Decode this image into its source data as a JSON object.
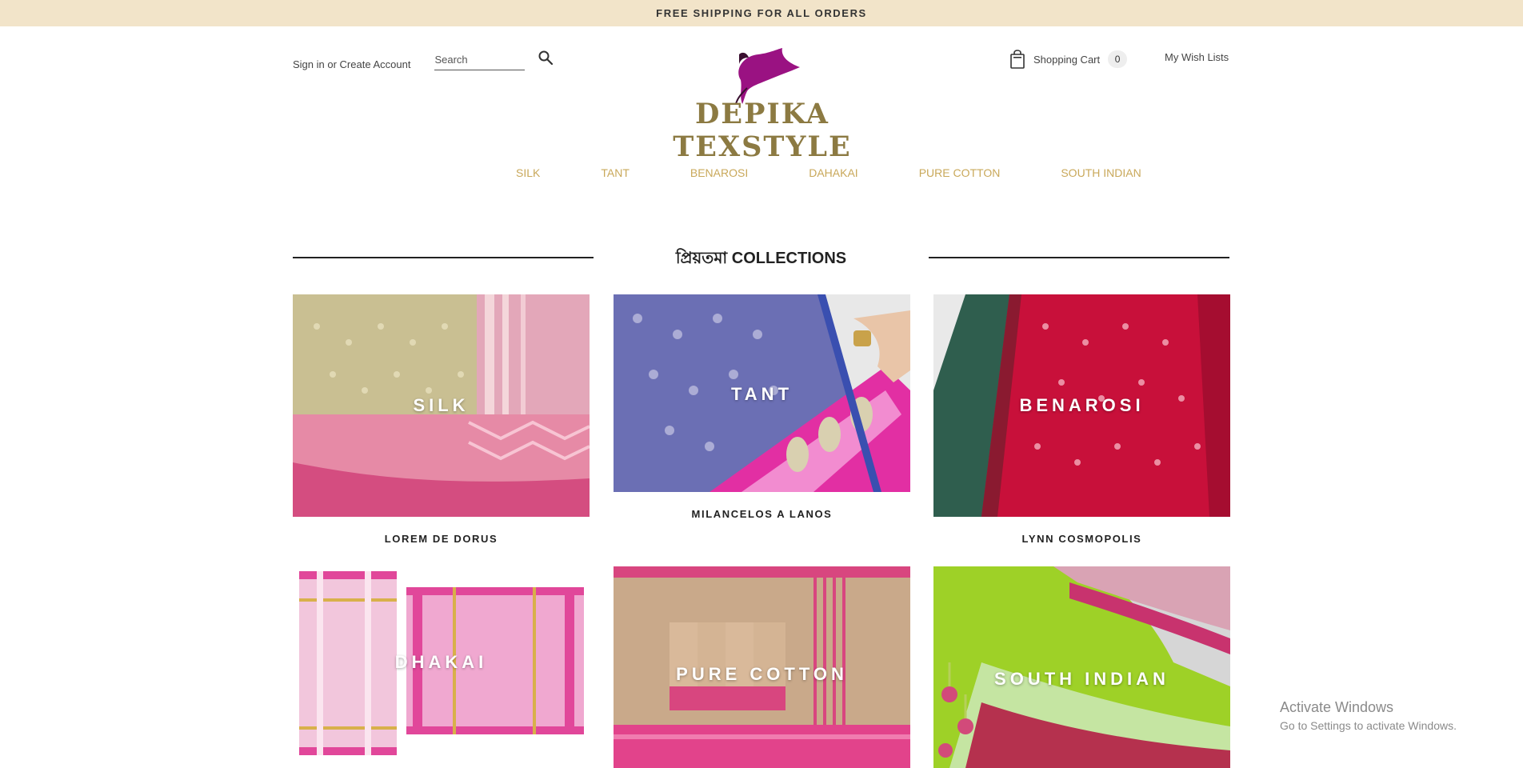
{
  "promo": {
    "text": "FREE SHIPPING FOR ALL ORDERS"
  },
  "header": {
    "signin": "Sign in",
    "or": " or ",
    "create_account": "Create Account",
    "search_placeholder": "Search",
    "cart_label": "Shopping Cart",
    "cart_count": "0",
    "wishlist": "My Wish Lists",
    "logo_text": "DEPIKA TEXSTYLE"
  },
  "nav": {
    "items": [
      {
        "label": "SILK"
      },
      {
        "label": "TANT"
      },
      {
        "label": "BENAROSI"
      },
      {
        "label": "DAHAKAI"
      },
      {
        "label": "PURE COTTON"
      },
      {
        "label": "SOUTH INDIAN"
      }
    ]
  },
  "collections": {
    "title": "প্রিয়তমা COLLECTIONS",
    "cards": [
      {
        "overlay": "SILK",
        "caption": "LOREM DE DORUS"
      },
      {
        "overlay": "TANT",
        "caption": "MILANCELOS A LANOS"
      },
      {
        "overlay": "BENAROSI",
        "caption": "LYNN COSMOPOLIS"
      },
      {
        "overlay": "DHAKAI",
        "caption": ""
      },
      {
        "overlay": "PURE COTTON",
        "caption": ""
      },
      {
        "overlay": "SOUTH INDIAN",
        "caption": ""
      }
    ]
  },
  "os_notice": {
    "title": "Activate Windows",
    "subtitle": "Go to Settings to activate Windows."
  },
  "colors": {
    "promo_bg": "#f2e4c9",
    "nav_text": "#c9a85a",
    "logo_magenta": "#9a1282",
    "logo_gold": "#8c7a42"
  }
}
